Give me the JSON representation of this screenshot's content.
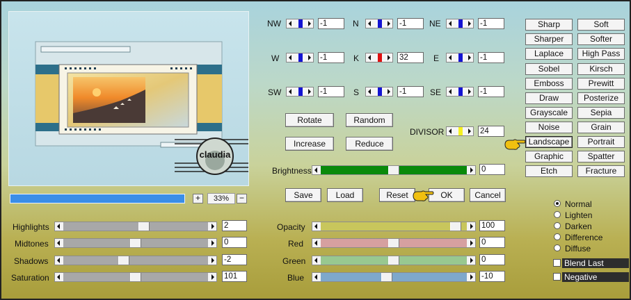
{
  "preview": {
    "watermark": "claudia"
  },
  "zoom": {
    "plus": "+",
    "value": "33%",
    "minus": "−"
  },
  "kernel": {
    "cells": [
      {
        "id": "nw",
        "label": "NW",
        "value": "-1",
        "thumb_color": "#1414d2"
      },
      {
        "id": "n",
        "label": "N",
        "value": "-1",
        "thumb_color": "#1414d2"
      },
      {
        "id": "ne",
        "label": "NE",
        "value": "-1",
        "thumb_color": "#1414d2"
      },
      {
        "id": "w",
        "label": "W",
        "value": "-1",
        "thumb_color": "#1414d2"
      },
      {
        "id": "k",
        "label": "K",
        "value": "32",
        "thumb_color": "#e01010"
      },
      {
        "id": "e",
        "label": "E",
        "value": "-1",
        "thumb_color": "#1414d2"
      },
      {
        "id": "sw",
        "label": "SW",
        "value": "-1",
        "thumb_color": "#1414d2"
      },
      {
        "id": "s",
        "label": "S",
        "value": "-1",
        "thumb_color": "#1414d2"
      },
      {
        "id": "se",
        "label": "SE",
        "value": "-1",
        "thumb_color": "#1414d2"
      }
    ],
    "divisor_label": "DIVISOR",
    "divisor_value": "24",
    "divisor_thumb_color": "#f5f020"
  },
  "actions": {
    "rotate": "Rotate",
    "random": "Random",
    "increase": "Increase",
    "reduce": "Reduce"
  },
  "brightness": {
    "label": "Brightness",
    "value": "0",
    "level_percent": 50,
    "color": "#0a8a0a"
  },
  "dialog": {
    "save": "Save",
    "load": "Load",
    "reset": "Reset",
    "ok": "OK",
    "cancel": "Cancel"
  },
  "filters": [
    "Sharp",
    "Soft",
    "Sharper",
    "Softer",
    "Laplace",
    "High Pass",
    "Sobel",
    "Kirsch",
    "Emboss",
    "Prewitt",
    "Draw",
    "Posterize",
    "Grayscale",
    "Sepia",
    "Noise",
    "Grain",
    "Landscape",
    "Portrait",
    "Graphic",
    "Spatter",
    "Etch",
    "Fracture"
  ],
  "selected_filter": "Landscape",
  "tone": [
    {
      "label": "Highlights",
      "value": "2",
      "level_percent": 56
    },
    {
      "label": "Midtones",
      "value": "0",
      "level_percent": 50
    },
    {
      "label": "Shadows",
      "value": "-2",
      "level_percent": 41
    },
    {
      "label": "Saturation",
      "value": "101",
      "level_percent": 50
    }
  ],
  "tone_track_color": "#a8a8a8",
  "color_sliders": [
    {
      "label": "Opacity",
      "value": "100",
      "level_percent": 96,
      "color": "#c8c65c"
    },
    {
      "label": "Red",
      "value": "0",
      "level_percent": 50,
      "color": "#d6a0a0"
    },
    {
      "label": "Green",
      "value": "0",
      "level_percent": 50,
      "color": "#98c890"
    },
    {
      "label": "Blue",
      "value": "-10",
      "level_percent": 45,
      "color": "#7ea8cc"
    }
  ],
  "blend_modes": [
    {
      "label": "Normal",
      "selected": true
    },
    {
      "label": "Lighten",
      "selected": false
    },
    {
      "label": "Darken",
      "selected": false
    },
    {
      "label": "Difference",
      "selected": false
    },
    {
      "label": "Diffuse",
      "selected": false
    }
  ],
  "options": [
    {
      "label": "Blend Last",
      "checked": false
    },
    {
      "label": "Negative",
      "checked": false
    }
  ],
  "pointer_color": "#f0c010"
}
